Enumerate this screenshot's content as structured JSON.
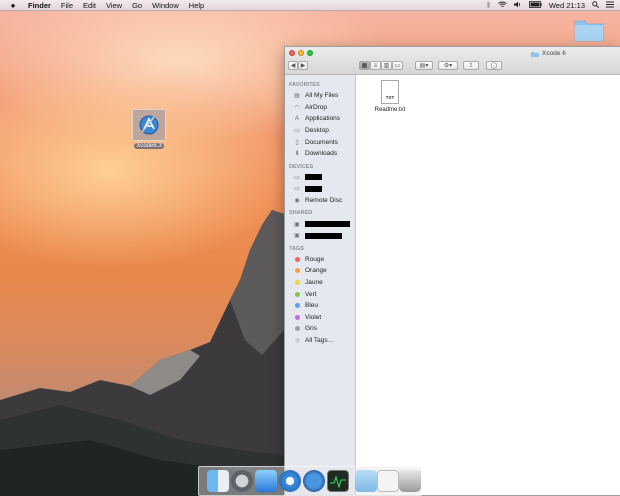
{
  "menubar": {
    "apple": "",
    "app_name": "Finder",
    "menus": [
      "File",
      "Edit",
      "View",
      "Go",
      "Window",
      "Help"
    ],
    "clock": "Wed 21:13"
  },
  "desktop": {
    "xcode_label": "Xcode6.3"
  },
  "finder": {
    "title": "Xcode 6",
    "sections": {
      "favorites": "FAVORITES",
      "devices": "DEVICES",
      "shared": "SHARED",
      "tags": "TAGS"
    },
    "favorites": [
      "All My Files",
      "AirDrop",
      "Applications",
      "Desktop",
      "Documents",
      "Downloads"
    ],
    "devices_remote": "Remote Disc",
    "tags": [
      {
        "label": "Rouge",
        "color": "#f0615a"
      },
      {
        "label": "Orange",
        "color": "#f5a23a"
      },
      {
        "label": "Jaune",
        "color": "#f0d23a"
      },
      {
        "label": "Vert",
        "color": "#7bc94a"
      },
      {
        "label": "Bleu",
        "color": "#5a9cf0"
      },
      {
        "label": "Violet",
        "color": "#c46ae0"
      },
      {
        "label": "Gris",
        "color": "#a0a0a0"
      },
      {
        "label": "All Tags…",
        "color": "#d0d0d0"
      }
    ],
    "file": {
      "name": "Readme.txt",
      "badge": "TXT"
    }
  }
}
